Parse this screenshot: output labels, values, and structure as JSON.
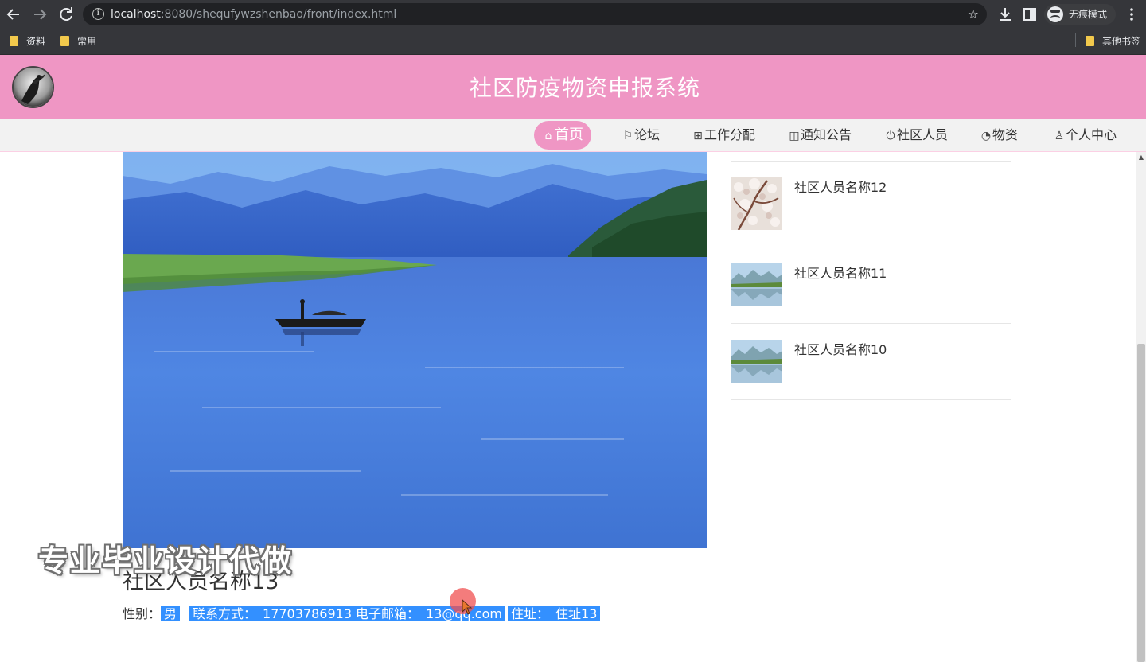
{
  "browser": {
    "url_host": "localhost",
    "url_path": ":8080/shequfywzshenbao/front/index.html",
    "incognito_label": "无痕模式",
    "bookmarks": [
      {
        "label": "资料"
      },
      {
        "label": "常用"
      }
    ],
    "other_bookmarks": "其他书签"
  },
  "header": {
    "title": "社区防疫物资申报系统"
  },
  "nav": {
    "items": [
      {
        "label": "首页",
        "icon": "home-icon",
        "active": true
      },
      {
        "label": "论坛",
        "icon": "flag-icon"
      },
      {
        "label": "工作分配",
        "icon": "apps-icon"
      },
      {
        "label": "通知公告",
        "icon": "notice-icon"
      },
      {
        "label": "社区人员",
        "icon": "power-icon"
      },
      {
        "label": "物资",
        "icon": "palette-icon"
      },
      {
        "label": "个人中心",
        "icon": "user-icon"
      }
    ]
  },
  "detail": {
    "name": "社区人员名称13",
    "gender_label": "性别：",
    "gender": "男",
    "phone_label": "联系方式：",
    "phone": "17703786913",
    "email_label": "电子邮箱：",
    "email": "13@qq.com",
    "address_label": "住址：",
    "address": "住址13"
  },
  "sidebar": {
    "items": [
      {
        "name": "社区人员名称12",
        "thumb": "blossom"
      },
      {
        "name": "社区人员名称11",
        "thumb": "lake"
      },
      {
        "name": "社区人员名称10",
        "thumb": "lake"
      }
    ]
  },
  "overlay": {
    "watermark": "专业毕业设计代做"
  },
  "colors": {
    "brand_pink": "#ef96c4",
    "selection_blue": "#3390ff",
    "chrome_dark": "#35363a"
  }
}
